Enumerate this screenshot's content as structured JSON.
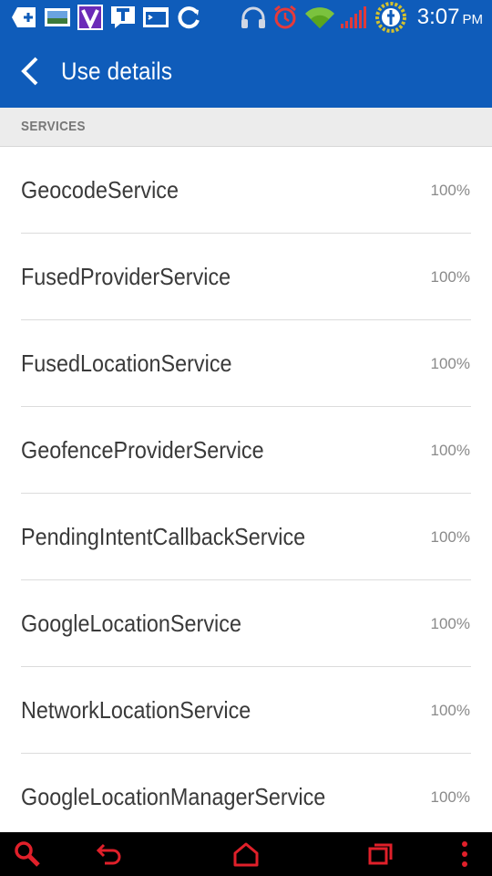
{
  "status_bar": {
    "time": "3:07",
    "ampm": "PM",
    "icons": [
      "add-icon",
      "gallery-icon",
      "viber-icon",
      "tmobile-icon",
      "terminal-icon",
      "sync-icon",
      "headphones-icon",
      "alarm-icon",
      "wifi-icon",
      "signal-icon",
      "battery-charging-icon"
    ]
  },
  "action_bar": {
    "back_icon": "chevron-left-icon",
    "title": "Use details"
  },
  "section": {
    "label": "SERVICES"
  },
  "services": [
    {
      "name": "GeocodeService",
      "percent": "100%"
    },
    {
      "name": "FusedProviderService",
      "percent": "100%"
    },
    {
      "name": "FusedLocationService",
      "percent": "100%"
    },
    {
      "name": "GeofenceProviderService",
      "percent": "100%"
    },
    {
      "name": "PendingIntentCallbackService",
      "percent": "100%"
    },
    {
      "name": "GoogleLocationService",
      "percent": "100%"
    },
    {
      "name": "NetworkLocationService",
      "percent": "100%"
    },
    {
      "name": "GoogleLocationManagerService",
      "percent": "100%"
    }
  ],
  "nav_bar": {
    "icons": [
      "search-icon",
      "back-icon",
      "home-icon",
      "recent-apps-icon",
      "menu-icon"
    ],
    "accent_color": "#e0202a"
  },
  "colors": {
    "primary": "#0f5cba",
    "section_bg": "#ececec"
  }
}
